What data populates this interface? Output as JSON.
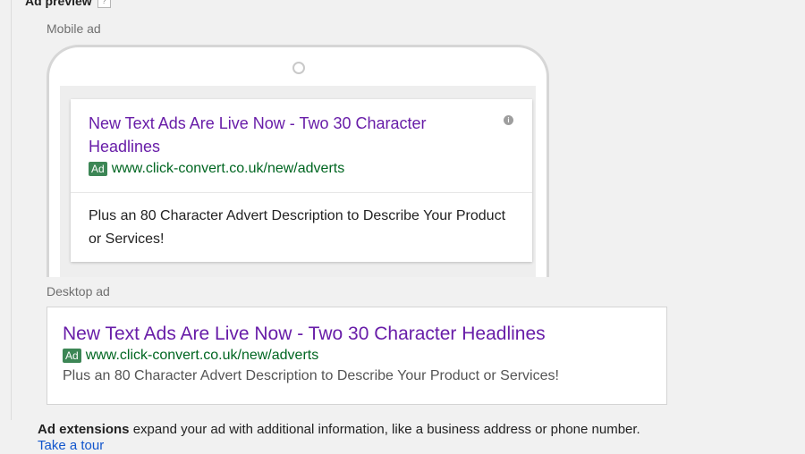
{
  "section": {
    "title": "Ad preview",
    "help_icon": "?"
  },
  "mobile": {
    "label": "Mobile ad",
    "headline": "New Text Ads Are Live Now - Two 30 Character Headlines",
    "info_icon": "i",
    "ad_badge": "Ad",
    "url": "www.click-convert.co.uk/new/adverts",
    "description": "Plus an 80 Character Advert Description to Describe Your Product or Services!"
  },
  "desktop": {
    "label": "Desktop ad",
    "headline": "New Text Ads Are Live Now - Two 30 Character Headlines",
    "ad_badge": "Ad",
    "url": "www.click-convert.co.uk/new/adverts",
    "description": "Plus an 80 Character Advert Description to Describe Your Product or Services!"
  },
  "extensions": {
    "bold_text": "Ad extensions",
    "text": " expand your ad with additional information, like a business address or phone number. ",
    "link": "Take a tour"
  },
  "colors": {
    "headline": "#681da8",
    "url": "#006621",
    "ad_badge": "#3c8655",
    "link": "#1155cc"
  }
}
